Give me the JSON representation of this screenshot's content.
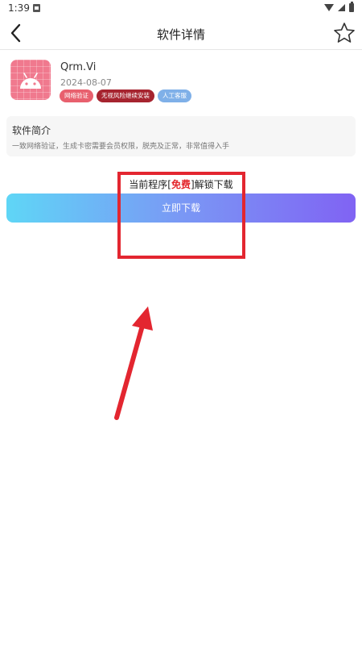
{
  "status_bar": {
    "time": "1:39"
  },
  "header": {
    "title": "软件详情"
  },
  "app": {
    "name": "Qrm.Vi",
    "date": "2024-08-07",
    "tags": [
      "网络验证",
      "无视风险继续安装",
      "人工客服"
    ]
  },
  "intro": {
    "title": "软件简介",
    "text": "一致网络验证，生成卡密需要会员权限，脱壳及正常，非常值得入手"
  },
  "download": {
    "note_prefix": "当前程序[",
    "note_free": "免费",
    "note_suffix": "]解锁下载",
    "button_label": "立即下载"
  },
  "colors": {
    "tag_primary": "#e8606e",
    "tag_dark": "#a6242f",
    "tag_blue": "#7fb0e8",
    "button_gradient_start": "#5fd6f6",
    "button_gradient_end": "#8063f3",
    "highlight": "#e32630",
    "free_text": "#e3262b"
  },
  "icons": {
    "back": "chevron-left-icon",
    "favorite": "star-outline-icon",
    "app": "android-icon"
  }
}
